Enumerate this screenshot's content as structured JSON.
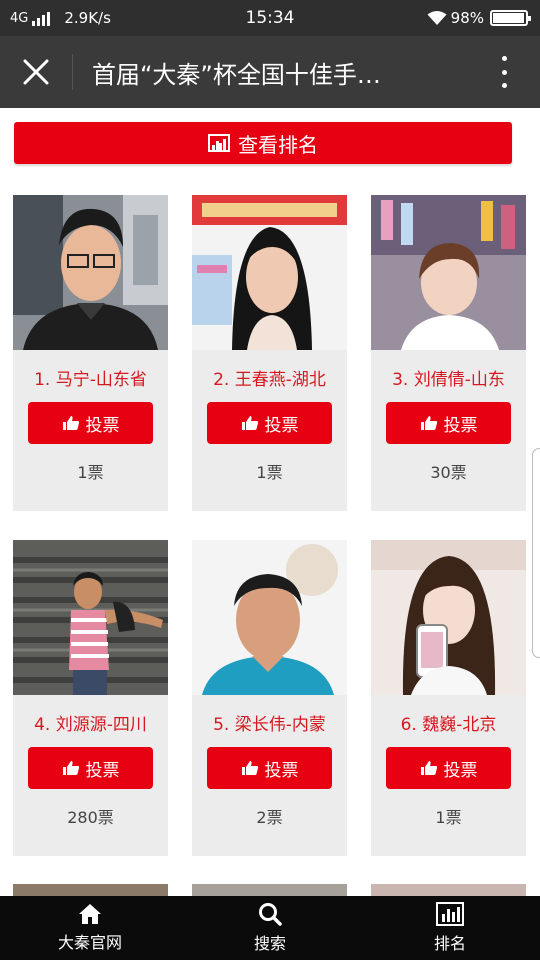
{
  "status": {
    "network": "4G",
    "speed": "2.9K/s",
    "time": "15:34",
    "battery": "98%"
  },
  "header": {
    "title": "首届“大秦”杯全国十佳手…",
    "close_icon": "close-icon",
    "more_icon": "more-vertical-icon"
  },
  "ranking_button": {
    "label": "查看排名",
    "icon": "bar-chart-icon"
  },
  "contestants": [
    {
      "name": "1. 马宁-山东省",
      "vote_label": "投票",
      "votes": "1票"
    },
    {
      "name": "2. 王春燕-湖北",
      "vote_label": "投票",
      "votes": "1票"
    },
    {
      "name": "3. 刘倩倩-山东",
      "vote_label": "投票",
      "votes": "30票"
    },
    {
      "name": "4. 刘源源-四川",
      "vote_label": "投票",
      "votes": "280票"
    },
    {
      "name": "5. 梁长伟-内蒙",
      "vote_label": "投票",
      "votes": "2票"
    },
    {
      "name": "6. 魏巍-北京",
      "vote_label": "投票",
      "votes": "1票"
    }
  ],
  "bottom_nav": [
    {
      "label": "大秦官网",
      "icon": "home-icon"
    },
    {
      "label": "搜索",
      "icon": "search-icon"
    },
    {
      "label": "排名",
      "icon": "bar-chart-icon"
    }
  ],
  "colors": {
    "accent": "#e60012",
    "name_red": "#d51920",
    "header_bg": "#3a3a3a",
    "nav_bg": "#0b0b0b"
  }
}
